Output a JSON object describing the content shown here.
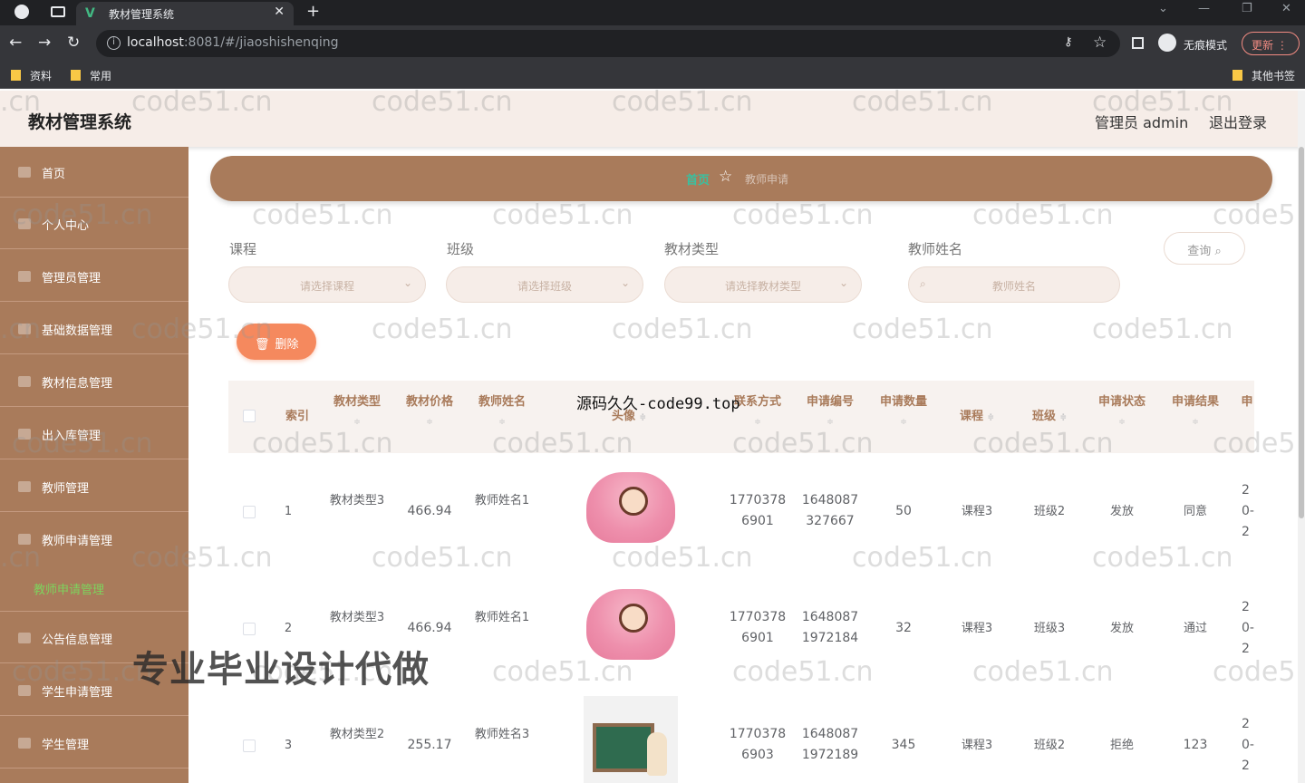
{
  "browser": {
    "tab_title": "教材管理系统",
    "url_host": "localhost",
    "url_rest": ":8081/#/jiaoshishenqing",
    "incognito_label": "无痕模式",
    "update_label": "更新",
    "bookmarks": [
      "资料",
      "常用"
    ],
    "other_bookmarks": "其他书签"
  },
  "header": {
    "title": "教材管理系统",
    "admin": "管理员 admin",
    "logout": "退出登录"
  },
  "sidebar": {
    "items": [
      {
        "label": "首页"
      },
      {
        "label": "个人中心"
      },
      {
        "label": "管理员管理"
      },
      {
        "label": "基础数据管理"
      },
      {
        "label": "教材信息管理"
      },
      {
        "label": "出入库管理"
      },
      {
        "label": "教师管理"
      },
      {
        "label": "教师申请管理"
      },
      {
        "label": "公告信息管理"
      },
      {
        "label": "学生申请管理"
      },
      {
        "label": "学生管理"
      }
    ],
    "submenu_active": "教师申请管理"
  },
  "breadcrumb": {
    "home": "首页",
    "current": "教师申请"
  },
  "filters": {
    "course_label": "课程",
    "course_placeholder": "请选择课程",
    "class_label": "班级",
    "class_placeholder": "请选择班级",
    "type_label": "教材类型",
    "type_placeholder": "请选择教材类型",
    "teacher_label": "教师姓名",
    "teacher_placeholder": "教师姓名",
    "query_label": "查询"
  },
  "actions": {
    "delete_label": "删除"
  },
  "table": {
    "headers": {
      "index": "索引",
      "type": "教材类型",
      "price": "教材价格",
      "teacher": "教师姓名",
      "avatar": "头像",
      "contact": "联系方式",
      "appno": "申请编号",
      "qty": "申请数量",
      "course": "课程",
      "class": "班级",
      "status": "申请状态",
      "result": "申请结果",
      "more": "申"
    },
    "rows": [
      {
        "index": "1",
        "type": "教材类型3",
        "price": "466.94",
        "teacher": "教师姓名1",
        "contact": "17703786901",
        "appno": "1648087327667",
        "qty": "50",
        "course": "课程3",
        "class": "班级2",
        "status": "发放",
        "result": "同意",
        "date": "20-2"
      },
      {
        "index": "2",
        "type": "教材类型3",
        "price": "466.94",
        "teacher": "教师姓名1",
        "contact": "17703786901",
        "appno": "16480871972184",
        "qty": "32",
        "course": "课程3",
        "class": "班级3",
        "status": "发放",
        "result": "通过",
        "date": "20-2"
      },
      {
        "index": "3",
        "type": "教材类型2",
        "price": "255.17",
        "teacher": "教师姓名3",
        "contact": "17703786903",
        "appno": "16480871972189",
        "qty": "345",
        "course": "课程3",
        "class": "班级2",
        "status": "拒绝",
        "result": "123",
        "date": "20-2"
      }
    ]
  },
  "watermarks": {
    "repeat": "code51.cn",
    "edge": ".cn",
    "cut": "code5",
    "center": "源码久久-code99.top",
    "promo": "专业毕业设计代做"
  }
}
